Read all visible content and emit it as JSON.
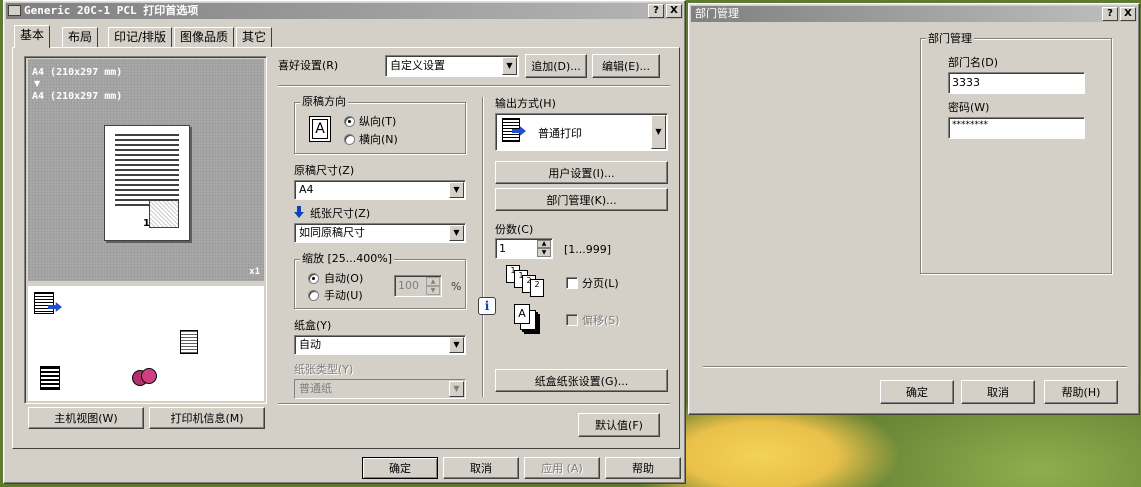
{
  "left_window": {
    "title": "Generic 20C-1 PCL 打印首选项",
    "help_btn": "?",
    "close_btn": "X",
    "tabs": [
      "基本",
      "布局",
      "印记/排版",
      "图像品质",
      "其它"
    ],
    "preview": {
      "line1": "A4 (210x297 mm)",
      "arrow": "▼",
      "line2": "A4 (210x297 mm)",
      "copies_mark": "x1",
      "page_number": "1"
    },
    "host_view_btn": "主机视图(W)",
    "printer_info_btn": "打印机信息(M)",
    "favorites": {
      "label": "喜好设置(R)",
      "value": "自定义设置",
      "add_btn": "追加(D)...",
      "edit_btn": "编辑(E)..."
    },
    "orientation": {
      "group": "原稿方向",
      "portrait": "纵向(T)",
      "landscape": "横向(N)"
    },
    "original_size": {
      "label": "原稿尺寸(Z)",
      "value": "A4"
    },
    "paper_size": {
      "label": "纸张尺寸(Z)",
      "value": "如同原稿尺寸"
    },
    "zoom": {
      "group": "缩放 [25...400%]",
      "auto": "自动(O)",
      "manual": "手动(U)",
      "value": "100",
      "unit": "%"
    },
    "tray": {
      "label": "纸盒(Y)",
      "value": "自动"
    },
    "paper_type": {
      "label": "纸张类型(Y)",
      "value": "普通纸"
    },
    "output": {
      "label": "输出方式(H)",
      "value": "普通打印",
      "user_settings_btn": "用户设置(I)...",
      "dept_mgmt_btn": "部门管理(K)..."
    },
    "copies": {
      "label": "份数(C)",
      "value": "1",
      "range": "[1...999]"
    },
    "collate": "分页(L)",
    "offset": "偏移(S)",
    "info_icon": "i",
    "tray_paper_btn": "纸盒纸张设置(G)...",
    "default_btn": "默认值(F)",
    "ok_btn": "确定",
    "cancel_btn": "取消",
    "apply_btn": "应用 (A)",
    "help_bottom_btn": "帮助"
  },
  "right_window": {
    "title": "部门管理",
    "help_btn": "?",
    "close_btn": "X",
    "group": "部门管理",
    "dept_name_label": "部门名(D)",
    "dept_name_value": "3333",
    "password_label": "密码(W)",
    "password_value": "********",
    "ok_btn": "确定",
    "cancel_btn": "取消",
    "help_btn_bottom": "帮助(H)"
  },
  "colors": {
    "face": "#d4d0c8",
    "title_inactive": "#808080",
    "accent_arrow": "#1040c0"
  }
}
